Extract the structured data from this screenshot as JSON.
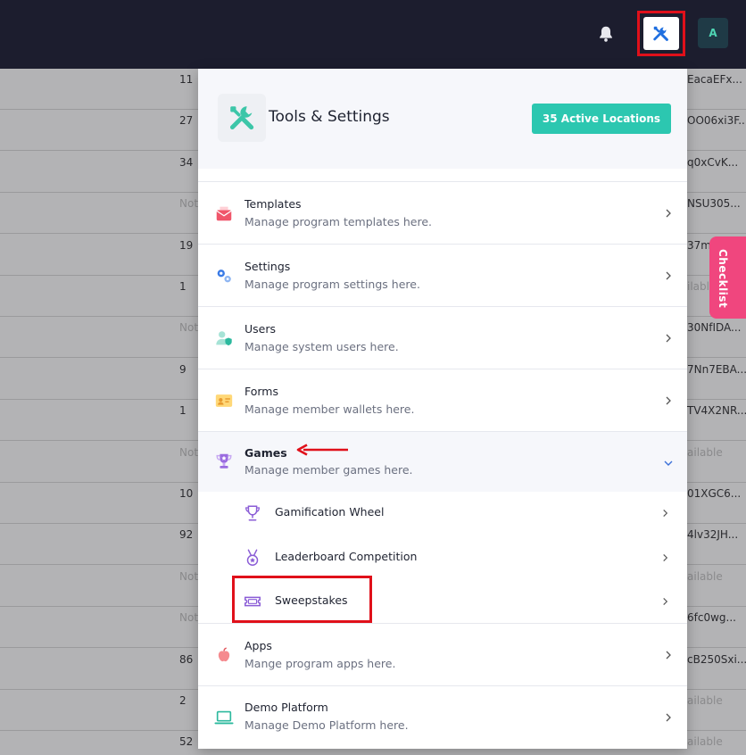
{
  "topbar": {
    "avatar_initial": "A",
    "icons": [
      "bell-icon",
      "tools-icon"
    ]
  },
  "background_rows": [
    {
      "left": "11",
      "right": "EacaEFx..."
    },
    {
      "left": "27",
      "right": "OO06xi3F..."
    },
    {
      "left": "34",
      "right": "q0xCvK..."
    },
    {
      "left": "Not",
      "right": "NSU305...",
      "left_muted": true
    },
    {
      "left": "19",
      "right": "37m"
    },
    {
      "left": "1",
      "right": "ilable",
      "right_muted": true
    },
    {
      "left": "Not",
      "right": "30NfIDA...",
      "left_muted": true
    },
    {
      "left": "9",
      "right": "7Nn7EBA..."
    },
    {
      "left": "1",
      "right": "TV4X2NR..."
    },
    {
      "left": "Not",
      "right": "ailable",
      "left_muted": true,
      "right_muted": true
    },
    {
      "left": "10",
      "right": "01XGC6..."
    },
    {
      "left": "92",
      "right": "4lv32JH..."
    },
    {
      "left": "Not",
      "right": "ailable",
      "left_muted": true,
      "right_muted": true
    },
    {
      "left": "Not",
      "right": "6fc0wg...",
      "left_muted": true
    },
    {
      "left": "86",
      "right": "cB250Sxi..."
    },
    {
      "left": "2",
      "right": "ailable",
      "right_muted": true
    },
    {
      "left": "52",
      "right": "ailable",
      "right_muted": true
    }
  ],
  "checklist_label": "Checklist",
  "panel": {
    "title": "Tools & Settings",
    "active_locations": "35 Active Locations",
    "items": [
      {
        "title": "Templates",
        "desc": "Manage program templates here."
      },
      {
        "title": "Settings",
        "desc": "Manage program settings here."
      },
      {
        "title": "Users",
        "desc": "Manage system users here."
      },
      {
        "title": "Forms",
        "desc": "Manage member wallets here."
      },
      {
        "title": "Games",
        "desc": "Manage member games here."
      },
      {
        "title": "Apps",
        "desc": "Mange program apps here."
      },
      {
        "title": "Demo Platform",
        "desc": "Manage Demo Platform here."
      }
    ],
    "games_sub": [
      {
        "label": "Gamification Wheel"
      },
      {
        "label": "Leaderboard Competition"
      },
      {
        "label": "Sweepstakes"
      }
    ]
  },
  "colors": {
    "topbar": "#1c1d2e",
    "accent_teal": "#2cc7b0",
    "checklist_pink": "#f0467e",
    "annotation_red": "#e0101a"
  }
}
